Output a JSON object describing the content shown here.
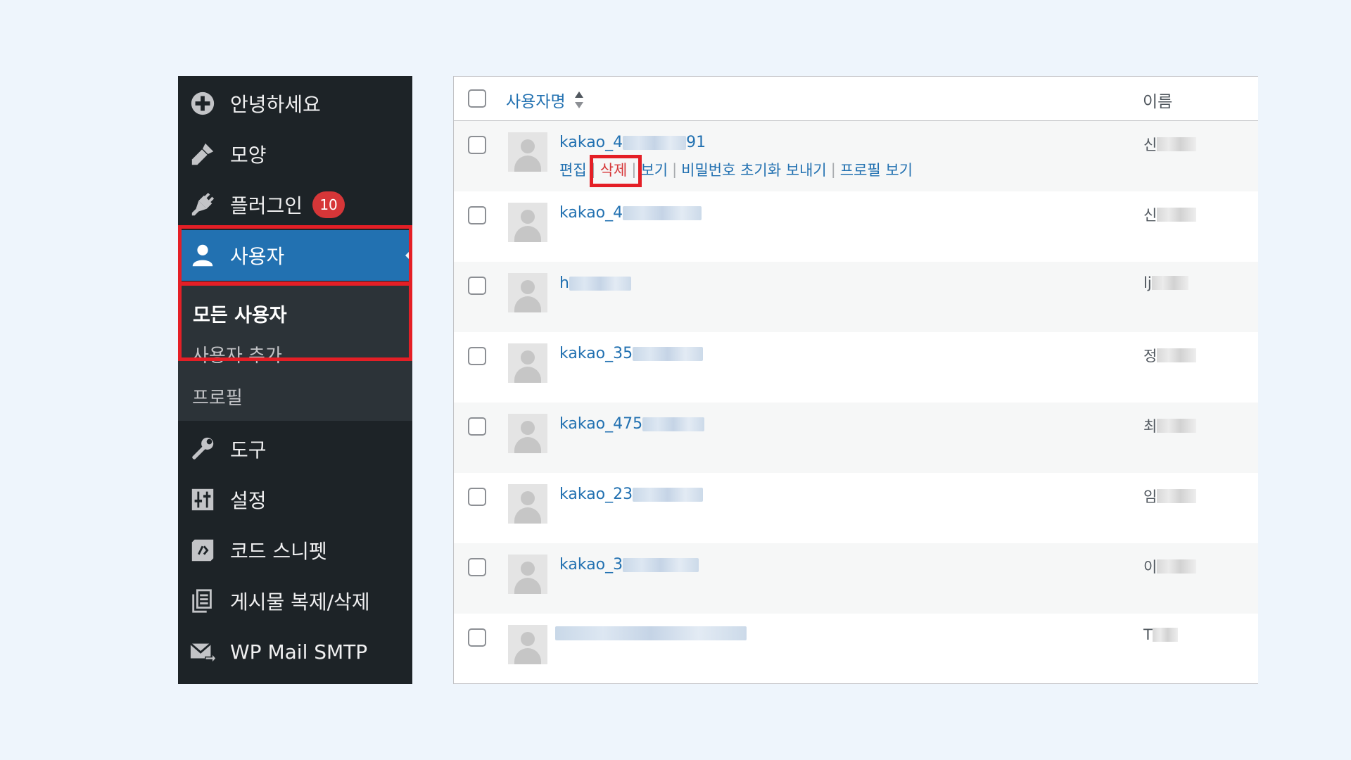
{
  "sidebar": {
    "items": [
      {
        "label": "안녕하세요",
        "icon": "plus-circle-icon"
      },
      {
        "label": "모양",
        "icon": "paintbrush-icon"
      },
      {
        "label": "플러그인",
        "icon": "plugin-icon",
        "badge": "10"
      },
      {
        "label": "사용자",
        "icon": "users-icon",
        "active": true
      },
      {
        "label": "도구",
        "icon": "wrench-icon"
      },
      {
        "label": "설정",
        "icon": "settings-sliders-icon"
      },
      {
        "label": "코드 스니펫",
        "icon": "code-snippet-icon"
      },
      {
        "label": "게시물 복제/삭제",
        "icon": "duplicate-icon"
      },
      {
        "label": "WP Mail SMTP",
        "icon": "mail-icon"
      }
    ],
    "submenu": [
      {
        "label": "모든 사용자",
        "current": true
      },
      {
        "label": "사용자 추가"
      },
      {
        "label": "프로필"
      }
    ]
  },
  "table": {
    "columns": {
      "username": "사용자명",
      "name": "이름"
    },
    "row_actions": [
      "편집",
      "삭제",
      "보기",
      "비밀번호 초기화 보내기",
      "프로필 보기"
    ],
    "rows": [
      {
        "username_visible": "kakao_4",
        "username_suffix": "91",
        "name_visible": "신"
      },
      {
        "username_visible": "kakao_4",
        "username_suffix": "",
        "name_visible": "신"
      },
      {
        "username_visible": "h",
        "username_suffix": "",
        "name_visible": "lj"
      },
      {
        "username_visible": "kakao_35",
        "username_suffix": "",
        "name_visible": "정"
      },
      {
        "username_visible": "kakao_475",
        "username_suffix": "",
        "name_visible": "최"
      },
      {
        "username_visible": "kakao_23",
        "username_suffix": "",
        "name_visible": "임"
      },
      {
        "username_visible": "kakao_3",
        "username_suffix": "",
        "name_visible": "이"
      },
      {
        "username_visible": "",
        "username_suffix": "",
        "name_visible": "T"
      }
    ]
  },
  "colors": {
    "sidebar_bg": "#1d2327",
    "active_bg": "#2271b1",
    "link": "#2271b1",
    "highlight_box": "#e41f26",
    "badge": "#d63638"
  }
}
